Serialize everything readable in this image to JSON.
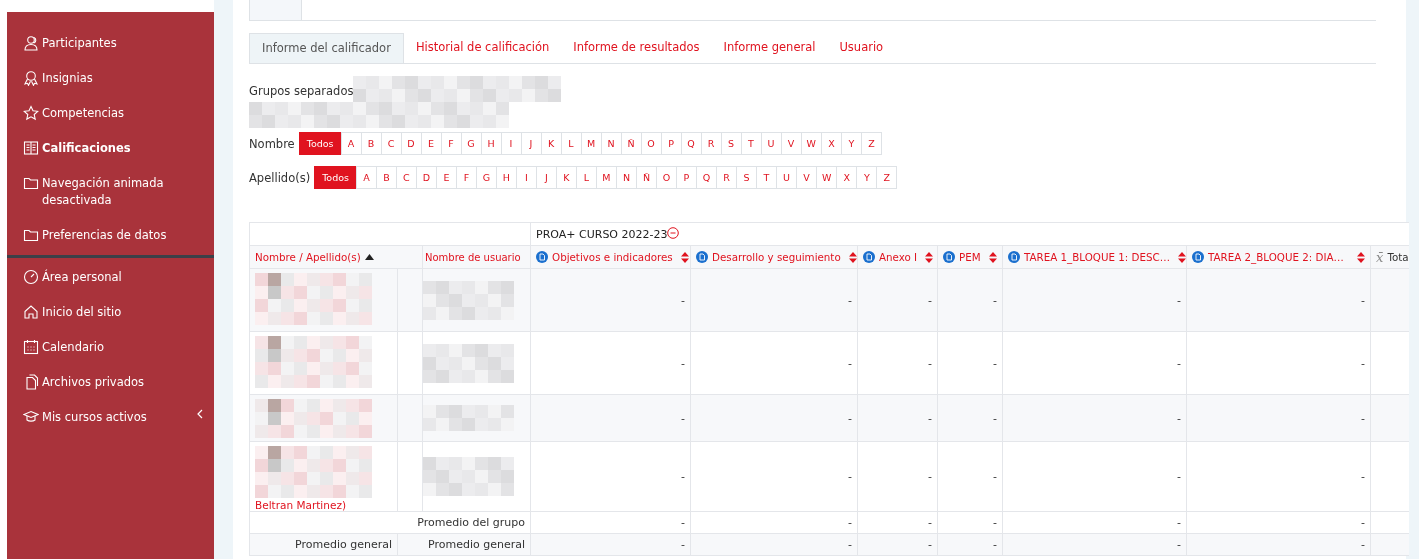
{
  "sidebar": {
    "sections": [
      {
        "items": [
          {
            "label": "Participantes",
            "selected": false
          },
          {
            "label": "Insignias",
            "selected": false
          },
          {
            "label": "Competencias",
            "selected": false
          },
          {
            "label": "Calificaciones",
            "selected": true
          },
          {
            "label": "Navegación animada desactivada",
            "selected": false
          },
          {
            "label": "Preferencias de datos",
            "selected": false
          }
        ]
      },
      {
        "items": [
          {
            "label": "Área personal",
            "selected": false
          },
          {
            "label": "Inicio del sitio",
            "selected": false
          },
          {
            "label": "Calendario",
            "selected": false
          },
          {
            "label": "Archivos privados",
            "selected": false
          },
          {
            "label": "Mis cursos activos",
            "selected": false,
            "expanded": false
          }
        ]
      }
    ]
  },
  "report_tabs": [
    {
      "label": "Informe del calificador",
      "selected": true
    },
    {
      "label": "Historial de calificación",
      "selected": false
    },
    {
      "label": "Informe de resultados",
      "selected": false
    },
    {
      "label": "Informe general",
      "selected": false
    },
    {
      "label": "Usuario",
      "selected": false
    }
  ],
  "groups": {
    "label": "Grupos separados"
  },
  "filters": [
    {
      "label": "Nombre",
      "letters": [
        {
          "label": "Todos",
          "selected": true
        },
        {
          "label": "A",
          "selected": false
        },
        {
          "label": "B",
          "selected": false
        },
        {
          "label": "C",
          "selected": false
        },
        {
          "label": "D",
          "selected": false
        },
        {
          "label": "E",
          "selected": false
        },
        {
          "label": "F",
          "selected": false
        },
        {
          "label": "G",
          "selected": false
        },
        {
          "label": "H",
          "selected": false
        },
        {
          "label": "I",
          "selected": false
        },
        {
          "label": "J",
          "selected": false
        },
        {
          "label": "K",
          "selected": false
        },
        {
          "label": "L",
          "selected": false
        },
        {
          "label": "M",
          "selected": false
        },
        {
          "label": "N",
          "selected": false
        },
        {
          "label": "Ñ",
          "selected": false
        },
        {
          "label": "O",
          "selected": false
        },
        {
          "label": "P",
          "selected": false
        },
        {
          "label": "Q",
          "selected": false
        },
        {
          "label": "R",
          "selected": false
        },
        {
          "label": "S",
          "selected": false
        },
        {
          "label": "T",
          "selected": false
        },
        {
          "label": "U",
          "selected": false
        },
        {
          "label": "V",
          "selected": false
        },
        {
          "label": "W",
          "selected": false
        },
        {
          "label": "X",
          "selected": false
        },
        {
          "label": "Y",
          "selected": false
        },
        {
          "label": "Z",
          "selected": false
        }
      ]
    },
    {
      "label": "Apellido(s)",
      "letters": [
        {
          "label": "Todos",
          "selected": true
        },
        {
          "label": "A",
          "selected": false
        },
        {
          "label": "B",
          "selected": false
        },
        {
          "label": "C",
          "selected": false
        },
        {
          "label": "D",
          "selected": false
        },
        {
          "label": "E",
          "selected": false
        },
        {
          "label": "F",
          "selected": false
        },
        {
          "label": "G",
          "selected": false
        },
        {
          "label": "H",
          "selected": false
        },
        {
          "label": "I",
          "selected": false
        },
        {
          "label": "J",
          "selected": false
        },
        {
          "label": "K",
          "selected": false
        },
        {
          "label": "L",
          "selected": false
        },
        {
          "label": "M",
          "selected": false
        },
        {
          "label": "N",
          "selected": false
        },
        {
          "label": "Ñ",
          "selected": false
        },
        {
          "label": "O",
          "selected": false
        },
        {
          "label": "P",
          "selected": false
        },
        {
          "label": "Q",
          "selected": false
        },
        {
          "label": "R",
          "selected": false
        },
        {
          "label": "S",
          "selected": false
        },
        {
          "label": "T",
          "selected": false
        },
        {
          "label": "U",
          "selected": false
        },
        {
          "label": "V",
          "selected": false
        },
        {
          "label": "W",
          "selected": false
        },
        {
          "label": "X",
          "selected": false
        },
        {
          "label": "Y",
          "selected": false
        },
        {
          "label": "Z",
          "selected": false
        }
      ]
    }
  ],
  "grade_table": {
    "category": {
      "label": "PROA+ CURSO 2022-23",
      "collapsed": false
    },
    "columns": [
      {
        "label": "Nombre / Apellido(s)",
        "kind": "name",
        "sorted": true
      },
      {
        "label": "Nombre de usuario",
        "kind": "user"
      },
      {
        "label": "Objetivos e indicadores",
        "kind": "activity",
        "sorted": false
      },
      {
        "label": "Desarrollo y seguimiento",
        "kind": "activity",
        "sorted": false
      },
      {
        "label": "Anexo I",
        "kind": "activity",
        "sorted": false
      },
      {
        "label": "PEM",
        "kind": "activity",
        "sorted": false
      },
      {
        "label": "TAREA 1_BLOQUE 1: DESC…",
        "kind": "activity",
        "sorted": false
      },
      {
        "label": "TAREA 2_BLOQUE 2: DIA…",
        "kind": "activity",
        "sorted": false
      },
      {
        "label": "Tota",
        "kind": "total",
        "icon": "x̄"
      }
    ],
    "rows": [
      {
        "values": [
          "-",
          "-",
          "-",
          "-",
          "-",
          "-"
        ]
      },
      {
        "values": [
          "-",
          "-",
          "-",
          "-",
          "-",
          "-"
        ]
      },
      {
        "values": [
          "-",
          "-",
          "-",
          "-",
          "-",
          "-"
        ]
      },
      {
        "name_fragment": "Beltran Martinez)",
        "values": [
          "-",
          "-",
          "-",
          "-",
          "-",
          "-"
        ]
      }
    ],
    "group_average": {
      "label": "Promedio del grupo",
      "values": [
        "-",
        "-",
        "-",
        "-",
        "-",
        "-"
      ]
    },
    "overall_average": {
      "labels": [
        "Promedio general",
        "Promedio general"
      ],
      "values": [
        "-",
        "-",
        "-",
        "-",
        "-",
        "-"
      ]
    }
  }
}
